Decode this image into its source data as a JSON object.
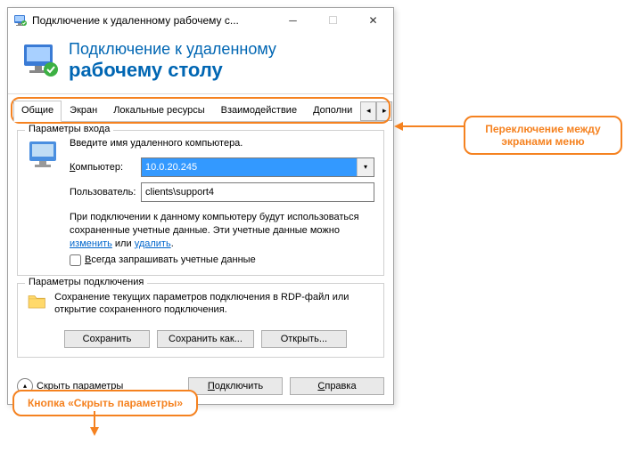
{
  "titlebar": {
    "text": "Подключение к удаленному рабочему с..."
  },
  "header": {
    "line1": "Подключение к удаленному",
    "line2": "рабочему столу"
  },
  "tabs": {
    "items": [
      {
        "label": "Общие"
      },
      {
        "label": "Экран"
      },
      {
        "label": "Локальные ресурсы"
      },
      {
        "label": "Взаимодействие"
      },
      {
        "label": "Дополни"
      }
    ]
  },
  "logon": {
    "group_title": "Параметры входа",
    "intro": "Введите имя удаленного компьютера.",
    "computer_label_pre": "К",
    "computer_label_rest": "омпьютер:",
    "computer_value": "10.0.20.245",
    "user_label": "Пользователь:",
    "user_value": "clients\\support4",
    "saved_pre": "При подключении к данному компьютеру будут использоваться сохраненные учетные данные.  Эти учетные данные можно ",
    "link_edit": "изменить",
    "saved_mid": " или ",
    "link_delete": "удалить",
    "saved_post": ".",
    "always_pre": "В",
    "always_rest": "сегда запрашивать учетные данные"
  },
  "conn": {
    "group_title": "Параметры подключения",
    "text": "Сохранение текущих параметров подключения в RDP-файл или открытие сохраненного подключения.",
    "save": "Сохранить",
    "save_as": "Сохранить как...",
    "open": "Открыть..."
  },
  "footer": {
    "hide_pre": "Скрыть ",
    "hide_u": "п",
    "hide_rest": "араметры",
    "connect_pre": "П",
    "connect_rest": "одключить",
    "help_pre": "С",
    "help_rest": "правка"
  },
  "callouts": {
    "c1": "Переключение между экранами меню",
    "c2": "Кнопка «Скрыть параметры»"
  }
}
